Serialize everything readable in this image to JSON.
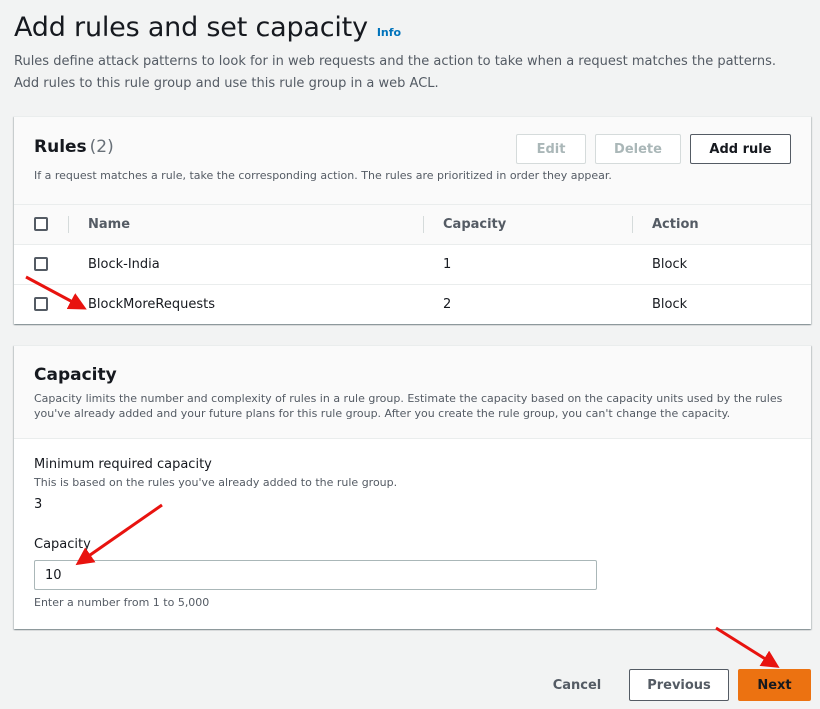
{
  "header": {
    "title": "Add rules and set capacity",
    "info_link": "Info",
    "description": "Rules define attack patterns to look for in web requests and the action to take when a request matches the patterns. Add rules to this rule group and use this rule group in a web ACL."
  },
  "rules": {
    "heading": "Rules",
    "count": "(2)",
    "subtitle": "If a request matches a rule, take the corresponding action. The rules are prioritized in order they appear.",
    "buttons": {
      "edit": "Edit",
      "delete": "Delete",
      "add_rule": "Add rule"
    },
    "columns": {
      "name": "Name",
      "capacity": "Capacity",
      "action": "Action"
    },
    "rows": [
      {
        "name": "Block-India",
        "capacity": "1",
        "action": "Block"
      },
      {
        "name": "BlockMoreRequests",
        "capacity": "2",
        "action": "Block"
      }
    ]
  },
  "capacity": {
    "heading": "Capacity",
    "description": "Capacity limits the number and complexity of rules in a rule group. Estimate the capacity based on the capacity units used by the rules you've already added and your future plans for this rule group. After you create the rule group, you can't change the capacity.",
    "min_label": "Minimum required capacity",
    "min_desc": "This is based on the rules you've already added to the rule group.",
    "min_value": "3",
    "input_label": "Capacity",
    "input_value": "10",
    "input_hint": "Enter a number from 1 to 5,000"
  },
  "footer": {
    "cancel": "Cancel",
    "previous": "Previous",
    "next": "Next"
  },
  "colors": {
    "accent": "#ec7211",
    "link": "#0073bb",
    "annotation": "#e8130f"
  }
}
